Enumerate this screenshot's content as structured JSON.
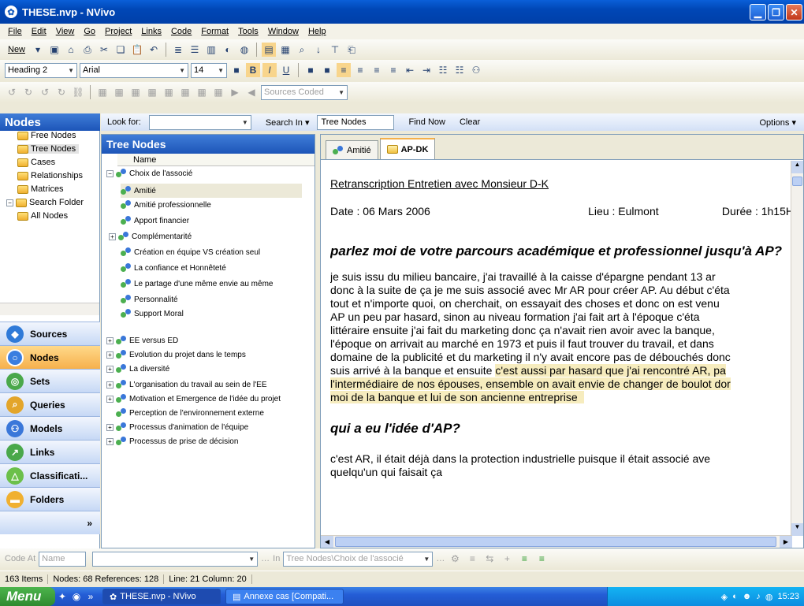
{
  "window": {
    "title": "THESE.nvp - NVivo"
  },
  "menu": [
    "File",
    "Edit",
    "View",
    "Go",
    "Project",
    "Links",
    "Code",
    "Format",
    "Tools",
    "Window",
    "Help"
  ],
  "toolbar1": {
    "new_label": "New"
  },
  "format_bar": {
    "style": "Heading 2",
    "font": "Arial",
    "size": "14"
  },
  "toolbar3": {
    "sources_coded": "Sources Coded"
  },
  "nav": {
    "header": "Nodes",
    "tree": [
      "Free Nodes",
      "Tree Nodes",
      "Cases",
      "Relationships",
      "Matrices",
      "Search Folder",
      "All Nodes"
    ],
    "buttons": [
      "Sources",
      "Nodes",
      "Sets",
      "Queries",
      "Models",
      "Links",
      "Classificati...",
      "Folders"
    ]
  },
  "find": {
    "look_for_label": "Look for:",
    "search_in_label": "Search In",
    "search_in_value": "Tree Nodes",
    "find_now": "Find Now",
    "clear": "Clear",
    "options": "Options"
  },
  "tree_pane": {
    "title": "Tree Nodes",
    "column_name": "Name",
    "rows": [
      "Choix de l'associé",
      "Amitié",
      "Amitié professionnelle",
      "Apport financier",
      "Complémentarité",
      "Création en équipe VS création seul",
      "La confiance et Honnêteté",
      "Le partage d'une même envie au même",
      "Personnalité",
      "Support Moral",
      "EE versus ED",
      "Evolution du projet dans le temps",
      "La diversité",
      "L'organisation du travail au sein de l'EE",
      "Motivation et Emergence de l'idée du projet",
      "Perception de l'environnement externe",
      "Processus d'animation de l'équipe",
      "Processus de prise de décision"
    ]
  },
  "doc": {
    "tabs": [
      "Amitié",
      "AP-DK"
    ],
    "heading": "Retranscription Entretien avec Monsieur D-K",
    "date": "Date : 06 Mars 2006",
    "lieu": "Lieu : Eulmont",
    "duree": "Durée : 1h15H",
    "q1": "parlez moi de votre parcours académique et professionnel jusqu'à AP?",
    "p1_lines": [
      "je suis issu du milieu bancaire, j'ai travaillé à la caisse d'épargne pendant 13 ar",
      "donc à la suite de ça je me suis associé avec Mr AR pour créer AP. Au début c'éta",
      "tout et n'importe quoi, on cherchait, on essayait des choses et donc on est venu",
      "AP un peu par hasard, sinon au niveau formation j'ai fait art à l'époque c'éta",
      "littéraire ensuite j'ai fait du marketing donc ça n'avait rien avoir avec la banque,",
      "l'époque on arrivait au marché en 1973 et puis il faut trouver du travail, et dans",
      "domaine de la publicité et du marketing il n'y avait encore pas de débouchés donc",
      "suis arrivé à la banque et ensuite "
    ],
    "hl_lines": [
      "c'est aussi par hasard que j'ai rencontré AR, pa",
      "l'intermédiaire de nos épouses, ensemble on avait envie de changer de boulot dor",
      "moi de la banque et lui de son ancienne entreprise"
    ],
    "q2": "qui a eu l'idée d'AP?",
    "p2_lines": [
      "c'est AR, il était déjà dans la protection industrielle puisque il était associé ave",
      "quelqu'un qui faisait ça"
    ]
  },
  "code_bar": {
    "code_at": "Code At",
    "name_placeholder": "Name",
    "in_label": "In",
    "path": "Tree Nodes\\Choix de l'associé"
  },
  "status": {
    "items": "163 Items",
    "counts": "Nodes: 68 References: 128",
    "position": "Line: 21 Column: 20"
  },
  "taskbar": {
    "start": "Menu",
    "tasks": [
      "THESE.nvp - NVivo",
      "Annexe cas [Compati..."
    ],
    "clock": "15:23"
  }
}
